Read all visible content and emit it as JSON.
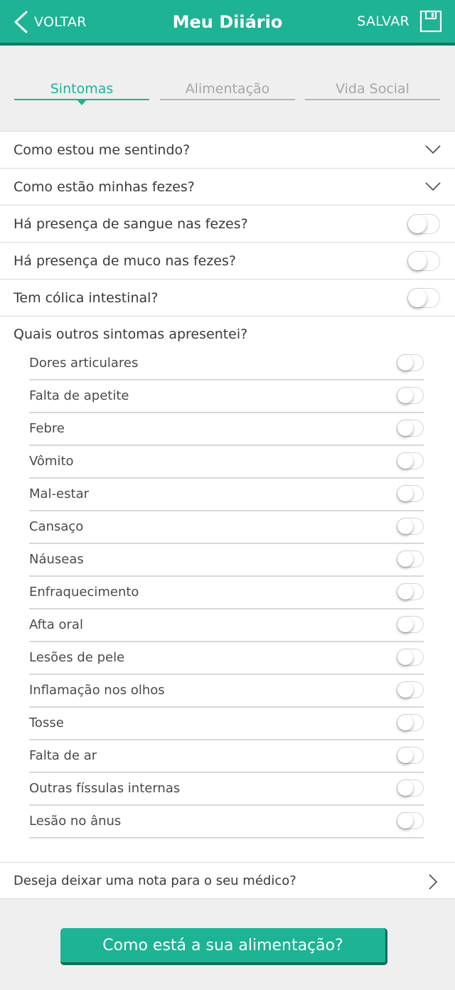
{
  "header": {
    "back_label": "VOLTAR",
    "title": "Meu Diiário",
    "save_label": "SALVAR"
  },
  "tabs": [
    {
      "label": "Sintomas",
      "active": true
    },
    {
      "label": "Alimentação",
      "active": false
    },
    {
      "label": "Vida Social",
      "active": false
    }
  ],
  "questions": {
    "feeling": "Como estou me sentindo?",
    "stool": "Como estão minhas fezes?",
    "blood": {
      "label": "Há presença de sangue nas fezes?",
      "on": false
    },
    "mucus": {
      "label": "Há presença de muco nas fezes?",
      "on": false
    },
    "colic": {
      "label": "Tem cólica intestinal?",
      "on": false
    }
  },
  "other_symptoms": {
    "heading": "Quais outros sintomas apresentei?",
    "items": [
      {
        "label": "Dores articulares",
        "on": false
      },
      {
        "label": "Falta de apetite",
        "on": false
      },
      {
        "label": "Febre",
        "on": false
      },
      {
        "label": "Vômito",
        "on": false
      },
      {
        "label": "Mal-estar",
        "on": false
      },
      {
        "label": "Cansaço",
        "on": false
      },
      {
        "label": "Náuseas",
        "on": false
      },
      {
        "label": "Enfraquecimento",
        "on": false
      },
      {
        "label": "Afta oral",
        "on": false
      },
      {
        "label": "Lesões de pele",
        "on": false
      },
      {
        "label": "Inflamação nos olhos",
        "on": false
      },
      {
        "label": "Tosse",
        "on": false
      },
      {
        "label": "Falta de ar",
        "on": false
      },
      {
        "label": "Outras físsulas internas",
        "on": false
      },
      {
        "label": "Lesão no ânus",
        "on": false
      }
    ]
  },
  "note": {
    "label": "Deseja deixar uma nota para o seu médico?"
  },
  "cta": {
    "label": "Como está a sua alimentação?"
  },
  "colors": {
    "accent": "#1db394",
    "accent_dark": "#0d7a63",
    "background": "#efefef"
  }
}
